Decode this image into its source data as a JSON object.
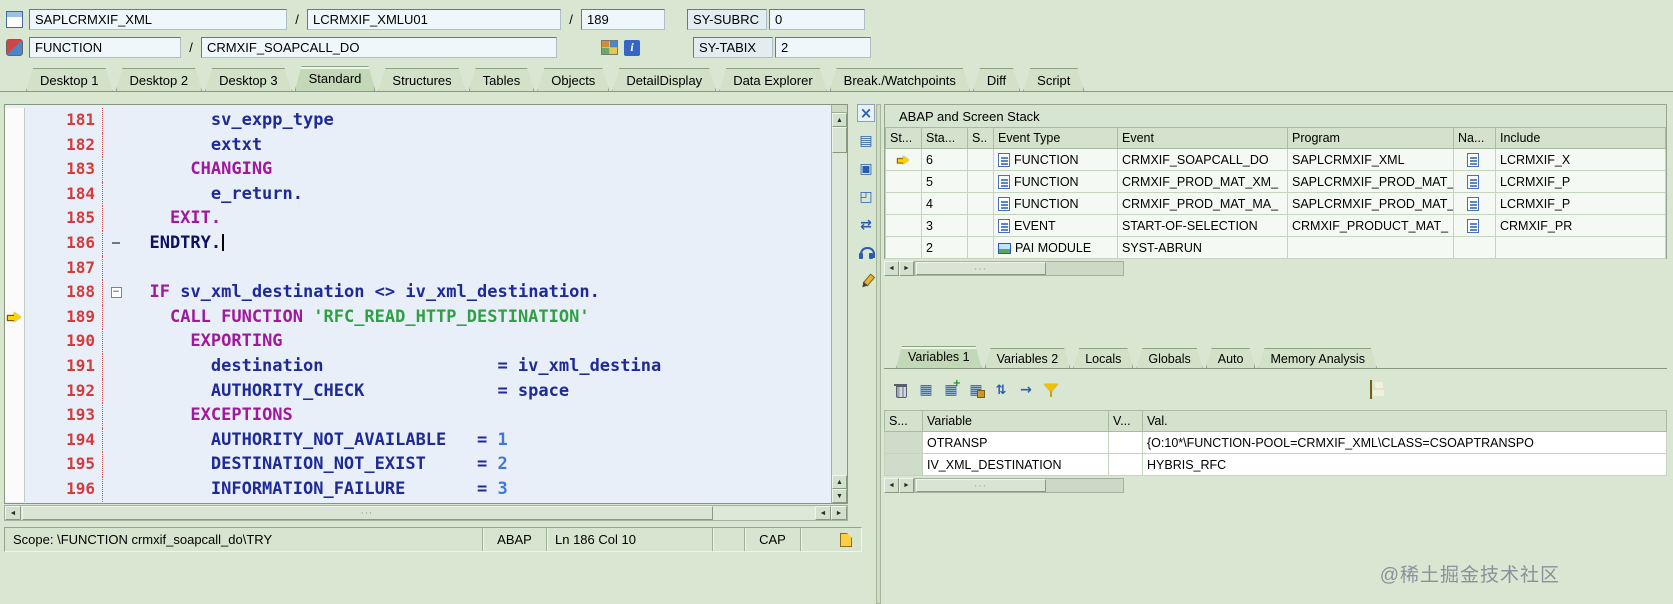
{
  "header": {
    "fields": {
      "program": "SAPLCRMXIF_XML",
      "separator1": "/",
      "include": "LCRMXIF_XMLU01",
      "separator2": "/",
      "line": "189",
      "sy_subrc_label": "SY-SUBRC",
      "sy_subrc_value": "0",
      "event_type": "FUNCTION",
      "separator3": "/",
      "event_name": "CRMXIF_SOAPCALL_DO",
      "sy_tabix_label": "SY-TABIX",
      "sy_tabix_value": "2"
    }
  },
  "icons": {
    "header_row1": "report-icon",
    "header_row2": "function-icon",
    "after_event": [
      "structure-icon",
      "info-icon"
    ],
    "editor_tools": [
      "close-icon",
      "copy-icon",
      "sessions-icon",
      "fullscreen-icon",
      "swap-icon",
      "services-icon",
      "edit-icon"
    ],
    "vars_toolbar": [
      "delete-icon",
      "table-icon",
      "table-add-icon",
      "table-save-icon",
      "sort-icon",
      "move-icon",
      "filter-icon"
    ],
    "vars_save": "save-icon",
    "statusbar": "insert-mode-icon"
  },
  "tabs": {
    "items": [
      {
        "label": "Desktop 1",
        "active": false
      },
      {
        "label": "Desktop 2",
        "active": false
      },
      {
        "label": "Desktop 3",
        "active": false
      },
      {
        "label": "Standard",
        "active": true
      },
      {
        "label": "Structures",
        "active": false
      },
      {
        "label": "Tables",
        "active": false
      },
      {
        "label": "Objects",
        "active": false
      },
      {
        "label": "DetailDisplay",
        "active": false
      },
      {
        "label": "Data Explorer",
        "active": false
      },
      {
        "label": "Break./Watchpoints",
        "active": false
      },
      {
        "label": "Diff",
        "active": false
      },
      {
        "label": "Script",
        "active": false
      }
    ]
  },
  "editor": {
    "current_line": 186,
    "execution_line": 189,
    "lines": [
      {
        "num": "181",
        "fold": "",
        "segs": [
          {
            "t": "        sv_expp_type",
            "c": "id"
          }
        ]
      },
      {
        "num": "182",
        "fold": "",
        "segs": [
          {
            "t": "        extxt",
            "c": "id"
          }
        ]
      },
      {
        "num": "183",
        "fold": "",
        "segs": [
          {
            "t": "      CHANGING",
            "c": "kw"
          }
        ]
      },
      {
        "num": "184",
        "fold": "",
        "segs": [
          {
            "t": "        e_return.",
            "c": "id"
          }
        ]
      },
      {
        "num": "185",
        "fold": "",
        "segs": [
          {
            "t": "    EXIT.",
            "c": "kw"
          }
        ]
      },
      {
        "num": "186",
        "fold": "dash",
        "cursor": true,
        "segs": [
          {
            "t": "  ENDTRY.",
            "c": "blk"
          }
        ]
      },
      {
        "num": "187",
        "fold": "",
        "segs": []
      },
      {
        "num": "188",
        "fold": "box",
        "segs": [
          {
            "t": "  ",
            "c": "id"
          },
          {
            "t": "IF ",
            "c": "kw"
          },
          {
            "t": "sv_xml_destination <> iv_xml_destination.",
            "c": "id"
          }
        ]
      },
      {
        "num": "189",
        "fold": "",
        "segs": [
          {
            "t": "    ",
            "c": "id"
          },
          {
            "t": "CALL FUNCTION ",
            "c": "kw"
          },
          {
            "t": "'RFC_READ_HTTP_DESTINATION'",
            "c": "str"
          }
        ]
      },
      {
        "num": "190",
        "fold": "",
        "segs": [
          {
            "t": "      ",
            "c": "id"
          },
          {
            "t": "EXPORTING",
            "c": "kw"
          }
        ]
      },
      {
        "num": "191",
        "fold": "",
        "segs": [
          {
            "t": "        destination                 = iv_xml_destina",
            "c": "id"
          }
        ]
      },
      {
        "num": "192",
        "fold": "",
        "segs": [
          {
            "t": "        AUTHORITY_CHECK             = space",
            "c": "id"
          }
        ]
      },
      {
        "num": "193",
        "fold": "",
        "segs": [
          {
            "t": "      ",
            "c": "id"
          },
          {
            "t": "EXCEPTIONS",
            "c": "kw"
          }
        ]
      },
      {
        "num": "194",
        "fold": "",
        "segs": [
          {
            "t": "        AUTHORITY_NOT_AVAILABLE   = ",
            "c": "id"
          },
          {
            "t": "1",
            "c": "num"
          }
        ]
      },
      {
        "num": "195",
        "fold": "",
        "segs": [
          {
            "t": "        DESTINATION_NOT_EXIST     = ",
            "c": "id"
          },
          {
            "t": "2",
            "c": "num"
          }
        ]
      },
      {
        "num": "196",
        "fold": "",
        "segs": [
          {
            "t": "        INFORMATION_FAILURE       = ",
            "c": "id"
          },
          {
            "t": "3",
            "c": "num"
          }
        ]
      }
    ]
  },
  "statusbar": {
    "scope": "Scope: \\FUNCTION crmxif_soapcall_do\\TRY",
    "language": "ABAP",
    "position": "Ln 186 Col 10",
    "caps": "CAP"
  },
  "stack": {
    "title": "ABAP and Screen Stack",
    "columns": [
      "St...",
      "Sta...",
      "S..",
      "Event Type",
      "Event",
      "Program",
      "Na...",
      "Include"
    ],
    "rows": [
      {
        "current": true,
        "level": "6",
        "event_type": "FUNCTION",
        "event": "CRMXIF_SOAPCALL_DO",
        "program": "SAPLCRMXIF_XML",
        "has_nav": true,
        "include": "LCRMXIF_X"
      },
      {
        "current": false,
        "level": "5",
        "event_type": "FUNCTION",
        "event": "CRMXIF_PROD_MAT_XM_",
        "program": "SAPLCRMXIF_PROD_MAT_",
        "has_nav": true,
        "include": "LCRMXIF_P"
      },
      {
        "current": false,
        "level": "4",
        "event_type": "FUNCTION",
        "event": "CRMXIF_PROD_MAT_MA_",
        "program": "SAPLCRMXIF_PROD_MAT_",
        "has_nav": true,
        "include": "LCRMXIF_P"
      },
      {
        "current": false,
        "level": "3",
        "event_type": "EVENT",
        "event": "START-OF-SELECTION",
        "program": "CRMXIF_PRODUCT_MAT_",
        "has_nav": true,
        "include": "CRMXIF_PR"
      },
      {
        "current": false,
        "level": "2",
        "event_type": "PAI MODULE",
        "event": "SYST-ABRUN",
        "program": "",
        "has_nav": false,
        "include": ""
      }
    ]
  },
  "variables": {
    "tabs": [
      {
        "label": "Variables 1",
        "active": true
      },
      {
        "label": "Variables 2",
        "active": false
      },
      {
        "label": "Locals",
        "active": false
      },
      {
        "label": "Globals",
        "active": false
      },
      {
        "label": "Auto",
        "active": false
      },
      {
        "label": "Memory Analysis",
        "active": false
      }
    ],
    "columns": [
      "S...",
      "Variable",
      "V...",
      "Val."
    ],
    "rows": [
      {
        "variable": "OTRANSP",
        "val": "{O:10*\\FUNCTION-POOL=CRMXIF_XML\\CLASS=CSOAPTRANSPO"
      },
      {
        "variable": "IV_XML_DESTINATION",
        "val": "HYBRIS_RFC"
      }
    ]
  },
  "watermark": "@稀土掘金技术社区"
}
